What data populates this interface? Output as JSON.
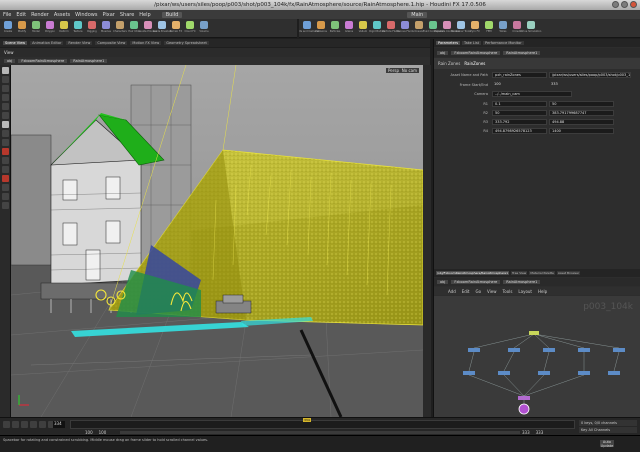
{
  "window": {
    "title": "/pixar/ws/users/siles/poop/p003/shot/p003_104k/fx/RainAtmosphere/source/RainAtmosphere.1.hip - Houdini FX 17.0.506"
  },
  "menubar": {
    "items": [
      "File",
      "Edit",
      "Render",
      "Assets",
      "Windows",
      "Pixar",
      "Share",
      "Help"
    ],
    "desktop": "Build",
    "desktop_right": "Main"
  },
  "shelf_left": {
    "tools": [
      "Create",
      "Modify",
      "Model",
      "Polygon",
      "Deform",
      "Texture",
      "Rigging",
      "Muscles",
      "Characters",
      "Hair Utils",
      "Guide Process",
      "Guide Brushes",
      "Terrain FX",
      "Cloud FX",
      "Volume"
    ]
  },
  "shelf_right": {
    "tools": [
      "Lights and Cameras",
      "Collisions",
      "Particles",
      "Grains",
      "Vellum",
      "Rigid Bodies",
      "Particle Fluids",
      "Viscous Fluids",
      "Oceans",
      "Fluid Containers",
      "Populate Containers",
      "Container Tools",
      "Pyro FX",
      "FEM",
      "Wires",
      "Crowds",
      "Drive Simulation"
    ]
  },
  "panel_tabs_left": [
    "Scene View",
    "Animation Editor",
    "Render View",
    "Composite View",
    "Motion FX View",
    "Geometry Spreadsheet"
  ],
  "panel_tabs_right": [
    "Parameters",
    "Take List",
    "Performance Monitor"
  ],
  "viewport": {
    "tab": "View",
    "path_obj": "obj",
    "path_node": "FxboomRainAtmosphere",
    "path_sub": "RainAtmosphere1",
    "persp": "Persp",
    "camera": "No cam",
    "colors": {
      "roof": "#1fae1a",
      "rain_volume": "#c8c31c",
      "particles": "#f6e83a",
      "water": "#33e0e0",
      "ground": "#5d5d5d"
    }
  },
  "params": {
    "node_type": "Rain Zones",
    "node_name": "RainZones",
    "asset_label": "Asset Name and Path",
    "asset_value": "pxh_rainZones",
    "asset_path": "/pixar/ws/users/siles/poop/p003/shot/p003_104k/fx",
    "frame_range_label": "Frame Start/End",
    "frame_start": "100",
    "frame_end": "333",
    "camera_label": "Camera",
    "camera_value": "../../main_cam",
    "rows": [
      {
        "label": "R1",
        "a": "0.1",
        "b": "50"
      },
      {
        "label": "R2",
        "a": "50",
        "b": "383.791799687747"
      },
      {
        "label": "R3",
        "a": "333.792",
        "b": "494.88"
      },
      {
        "label": "R4",
        "a": "494.8798926578123",
        "b": "1400"
      }
    ]
  },
  "network": {
    "tabs": [
      "/obj/FxboomRainAtmosphere/RainAtmosphere1",
      "Tree View",
      "Material Palette",
      "Asset Browser",
      "Node Parms",
      "Code Browser"
    ],
    "path_obj": "obj",
    "path_node": "FxboomRainAtmosphere",
    "path_sub": "RainAtmosphere1",
    "menu": [
      "Add",
      "Edit",
      "Go",
      "View",
      "Tools",
      "Layout",
      "Help"
    ],
    "watermark": "p003_104k"
  },
  "timeline": {
    "current_frame": "334",
    "cursor_label": "334",
    "start": "100",
    "start2": "100",
    "end": "333",
    "end2": "333",
    "keys_label": "0 keys, 0/0 channels",
    "key_all": "Key All Channels"
  },
  "status": {
    "message": "Spacebar for rotating and constrained scrubbing. Middle mouse drag on frame slider to hold scrolled channel values.",
    "button": "Auto Update"
  }
}
